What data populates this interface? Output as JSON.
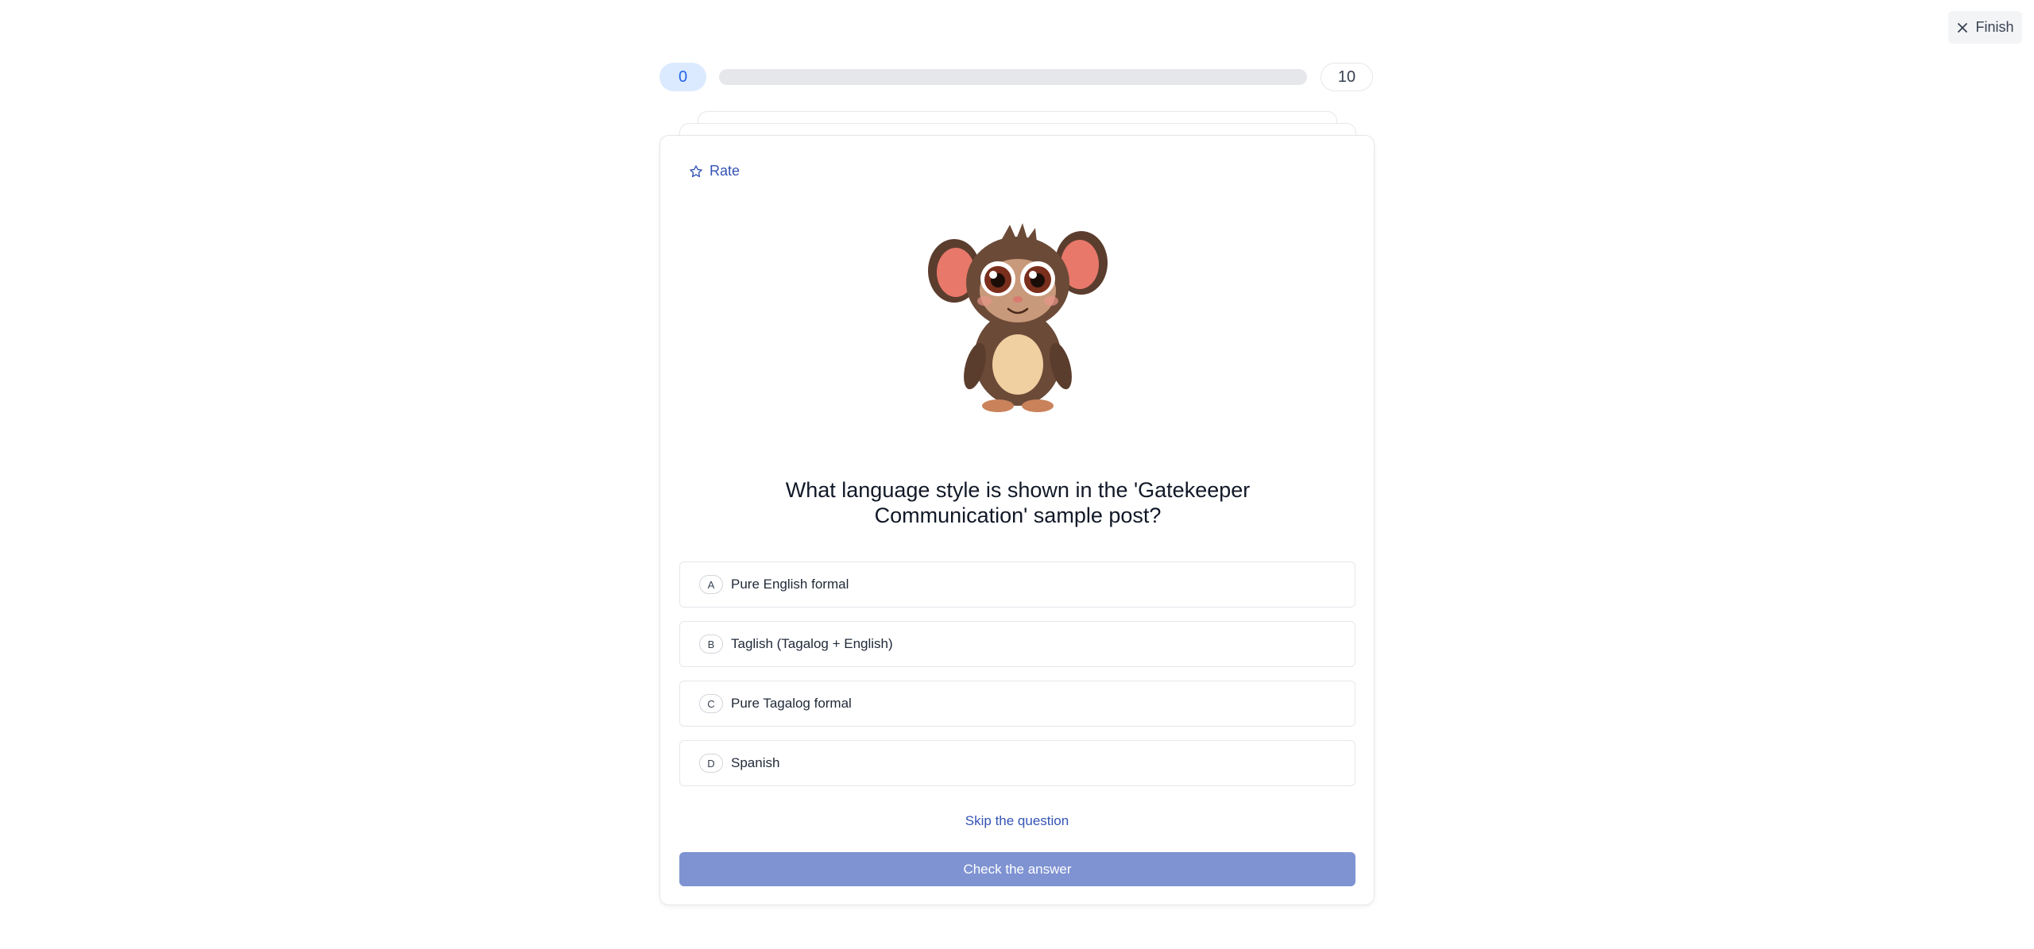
{
  "header": {
    "finish_label": "Finish"
  },
  "progress": {
    "current": "0",
    "total": "10",
    "fraction": 0
  },
  "card": {
    "rate_label": "Rate",
    "question": "What language style is shown in the 'Gatekeeper Communication' sample post?",
    "options": [
      {
        "letter": "A",
        "text": "Pure English formal"
      },
      {
        "letter": "B",
        "text": "Taglish (Tagalog + English)"
      },
      {
        "letter": "C",
        "text": "Pure Tagalog formal"
      },
      {
        "letter": "D",
        "text": "Spanish"
      }
    ],
    "skip_label": "Skip the question",
    "check_label": "Check the answer"
  },
  "icons": {
    "finish": "close-icon",
    "rate": "star-icon",
    "mascot": "tarsier-mascot"
  },
  "colors": {
    "accent": "#3454b4",
    "check_button": "#7f93d2",
    "progress_badge_bg": "#dbeafe",
    "progress_badge_text": "#2563eb"
  }
}
